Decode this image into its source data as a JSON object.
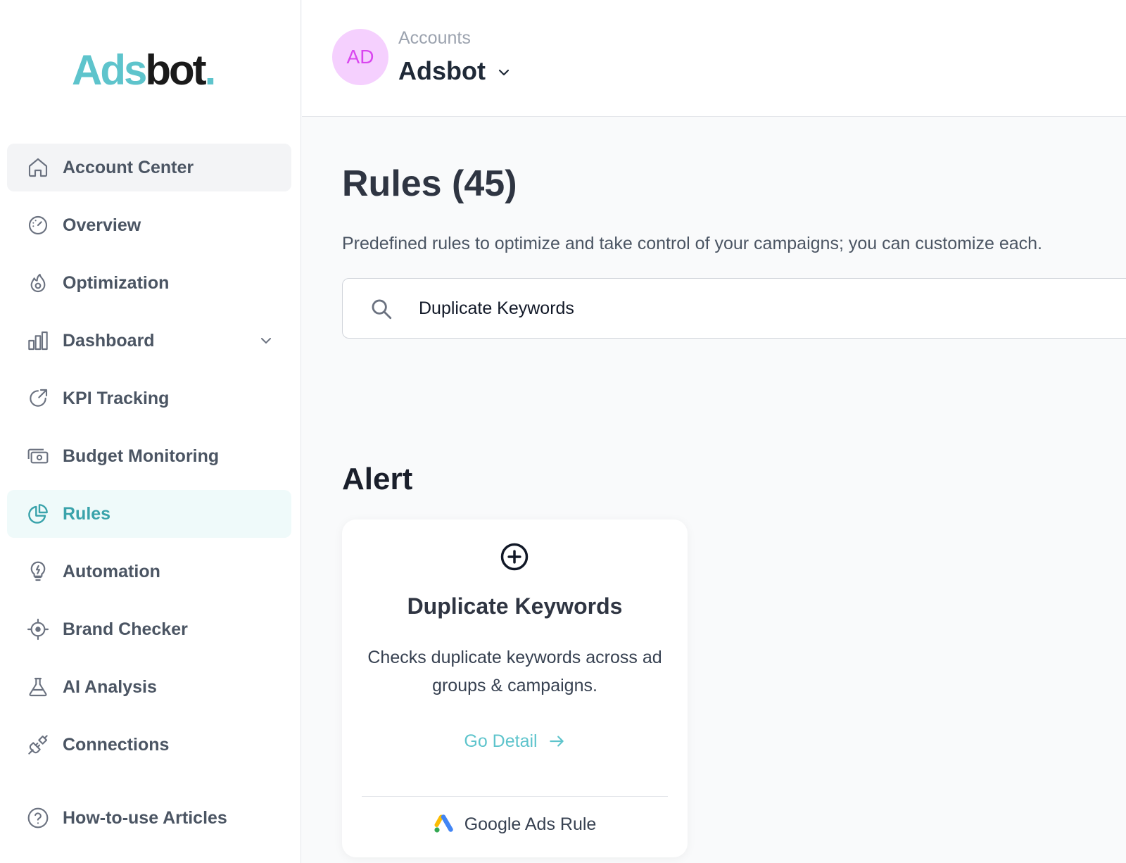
{
  "brand": {
    "logo_part1": "Ads",
    "logo_part2": "bot",
    "logo_dot": ".",
    "accent_color": "#5ec4cc"
  },
  "header": {
    "avatar_initials": "AD",
    "accounts_label": "Accounts",
    "account_name": "Adsbot"
  },
  "sidebar": {
    "items": [
      {
        "label": "Account Center",
        "icon": "home-icon"
      },
      {
        "label": "Overview",
        "icon": "gauge-icon"
      },
      {
        "label": "Optimization",
        "icon": "flame-icon"
      },
      {
        "label": "Dashboard",
        "icon": "bar-chart-icon"
      },
      {
        "label": "KPI Tracking",
        "icon": "arrow-up-right-circle-icon"
      },
      {
        "label": "Budget Monitoring",
        "icon": "money-icon"
      },
      {
        "label": "Rules",
        "icon": "pie-chart-icon"
      },
      {
        "label": "Automation",
        "icon": "lightbulb-bolt-icon"
      },
      {
        "label": "Brand Checker",
        "icon": "crosshair-icon"
      },
      {
        "label": "AI Analysis",
        "icon": "flask-icon"
      },
      {
        "label": "Connections",
        "icon": "plug-icon"
      },
      {
        "label": "How-to-use Articles",
        "icon": "help-circle-icon"
      }
    ],
    "active_item": "Rules"
  },
  "main": {
    "title": "Rules (45)",
    "subtitle": "Predefined rules to optimize and take control of your campaigns; you can customize each.",
    "search": {
      "value": "Duplicate Keywords",
      "placeholder": ""
    },
    "section_title": "Alert",
    "cards": [
      {
        "title": "Duplicate Keywords",
        "description": "Checks duplicate keywords across ad groups & campaigns.",
        "link_label": "Go Detail",
        "footer_label": "Google Ads Rule",
        "footer_icon": "google-ads-icon"
      }
    ]
  }
}
